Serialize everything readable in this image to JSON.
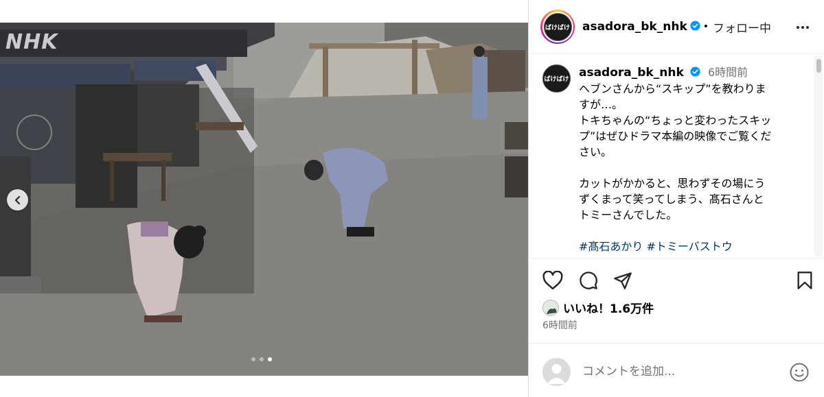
{
  "media": {
    "watermark": "NHK",
    "carousel": {
      "count": 3,
      "active_index": 2
    }
  },
  "header": {
    "username": "asadora_bk_nhk",
    "separator": "•",
    "follow_status": "フォロー中",
    "avatar_text": "ばけばけ"
  },
  "caption": {
    "username": "asadora_bk_nhk",
    "time": "6時間前",
    "avatar_text": "ばけばけ",
    "lines": [
      "ヘブンさんから“スキップ”を教わりま",
      "すが…。",
      "トキちゃんの“ちょっと変わったスキッ",
      "プ”はぜひドラマ本編の映像でご覧くだ",
      "さい。",
      "",
      "カットがかかると、思わずその場にう",
      "ずくまって笑ってしまう、髙石さんと",
      "トミーさんでした。",
      ""
    ],
    "hashtags": "#髙石あかり #トミーバストウ"
  },
  "engagement": {
    "likes_text": "いいね！1.6万件",
    "timestamp": "6時間前"
  },
  "comment": {
    "placeholder": "コメントを追加..."
  },
  "colors": {
    "verified": "#0095f6",
    "hashtag": "#00376b",
    "secondary_text": "#737373"
  }
}
